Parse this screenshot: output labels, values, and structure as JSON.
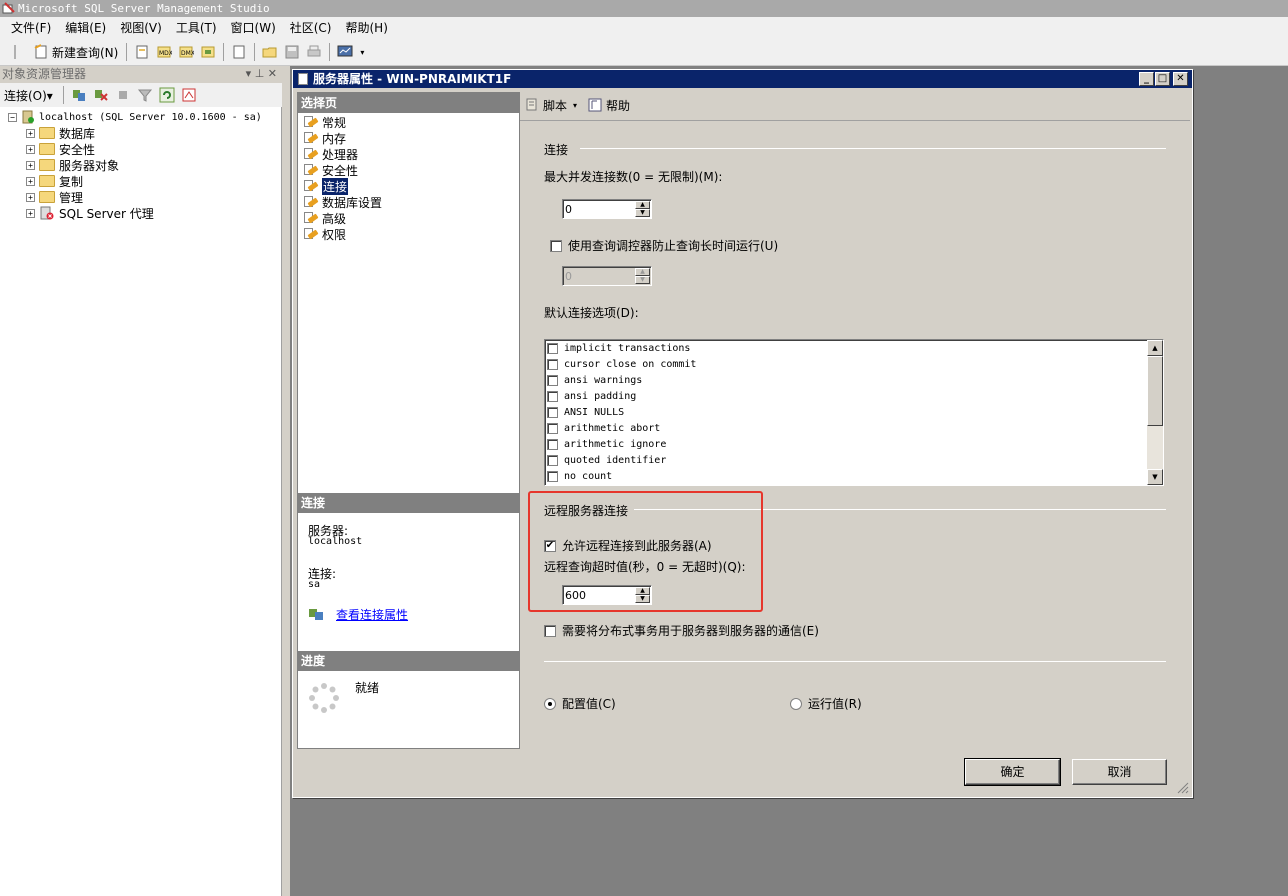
{
  "app": {
    "title": "Microsoft SQL Server Management Studio"
  },
  "menu": [
    "文件(F)",
    "编辑(E)",
    "视图(V)",
    "工具(T)",
    "窗口(W)",
    "社区(C)",
    "帮助(H)"
  ],
  "toolbar": {
    "new_query": "新建查询(N)"
  },
  "object_explorer": {
    "title": "对象资源管理器",
    "title_controls": "▾ ⊥ ✕",
    "connect_label": "连接(O)▾",
    "server_node": "localhost (SQL Server 10.0.1600 - sa)",
    "nodes": [
      "数据库",
      "安全性",
      "服务器对象",
      "复制",
      "管理",
      "SQL Server 代理"
    ]
  },
  "dialog": {
    "title": "服务器属性 - WIN-PNRAIMIKT1F",
    "select_page_header": "选择页",
    "pages": [
      "常规",
      "内存",
      "处理器",
      "安全性",
      "连接",
      "数据库设置",
      "高级",
      "权限"
    ],
    "selected_page": "连接",
    "connection_header": "连接",
    "server_label": "服务器:",
    "server_value": "localhost",
    "connection_label": "连接:",
    "connection_value": "sa",
    "view_conn_props": "查看连接属性",
    "progress_header": "进度",
    "progress_status": "就绪",
    "script_button": "脚本",
    "help_button": "帮助",
    "content": {
      "group_connections": "连接",
      "max_conn_label": "最大并发连接数(0 = 无限制)(M):",
      "max_conn_value": "0",
      "use_governor_label": "使用查询调控器防止查询长时间运行(U)",
      "use_governor_checked": false,
      "governor_value": "0",
      "default_options_label": "默认连接选项(D):",
      "default_options": [
        "implicit transactions",
        "cursor close on commit",
        "ansi warnings",
        "ansi padding",
        "ANSI NULLS",
        "arithmetic abort",
        "arithmetic ignore",
        "quoted identifier",
        "no count"
      ],
      "group_remote": "远程服务器连接",
      "allow_remote_label": "允许远程连接到此服务器(A)",
      "allow_remote_checked": true,
      "remote_timeout_label": "远程查询超时值(秒，0 = 无超时)(Q):",
      "remote_timeout_value": "600",
      "dist_tran_label": "需要将分布式事务用于服务器到服务器的通信(E)",
      "dist_tran_checked": false,
      "radio_configured": "配置值(C)",
      "radio_running": "运行值(R)",
      "selected_radio": "configured"
    },
    "ok_button": "确定",
    "cancel_button": "取消"
  },
  "colors": {
    "dialog_title_bg": "#0a246a",
    "highlight_border": "#e6362c",
    "link": "#0000ff"
  }
}
